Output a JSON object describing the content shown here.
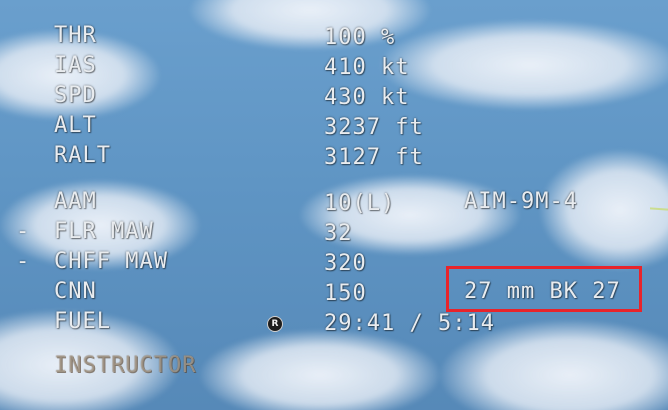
{
  "hud": {
    "flight": [
      {
        "label": "THR",
        "value": "100 %"
      },
      {
        "label": "IAS",
        "value": "410 kt"
      },
      {
        "label": "SPD",
        "value": "430 kt"
      },
      {
        "label": "ALT",
        "value": "3237 ft"
      },
      {
        "label": "RALT",
        "value": "3127 ft"
      }
    ],
    "weapons": [
      {
        "marker": "",
        "label": "AAM",
        "value": "10(L)",
        "extra": "AIM-9M-4"
      },
      {
        "marker": "-",
        "label": "FLR MAW",
        "value": "32",
        "extra": ""
      },
      {
        "marker": "-",
        "label": "CHFF MAW",
        "value": "320",
        "extra": ""
      },
      {
        "marker": "",
        "label": "CNN",
        "value": "150",
        "extra": "27 mm BK 27"
      },
      {
        "marker": "",
        "label": "FUEL",
        "value": "29:41 / 5:14",
        "extra": ""
      }
    ],
    "mode": "INSTRUCTOR",
    "r_mark": "R"
  },
  "colors": {
    "hud_text": "#e9ecef",
    "highlight": "#e8242b",
    "sky": "#5f95c4"
  }
}
